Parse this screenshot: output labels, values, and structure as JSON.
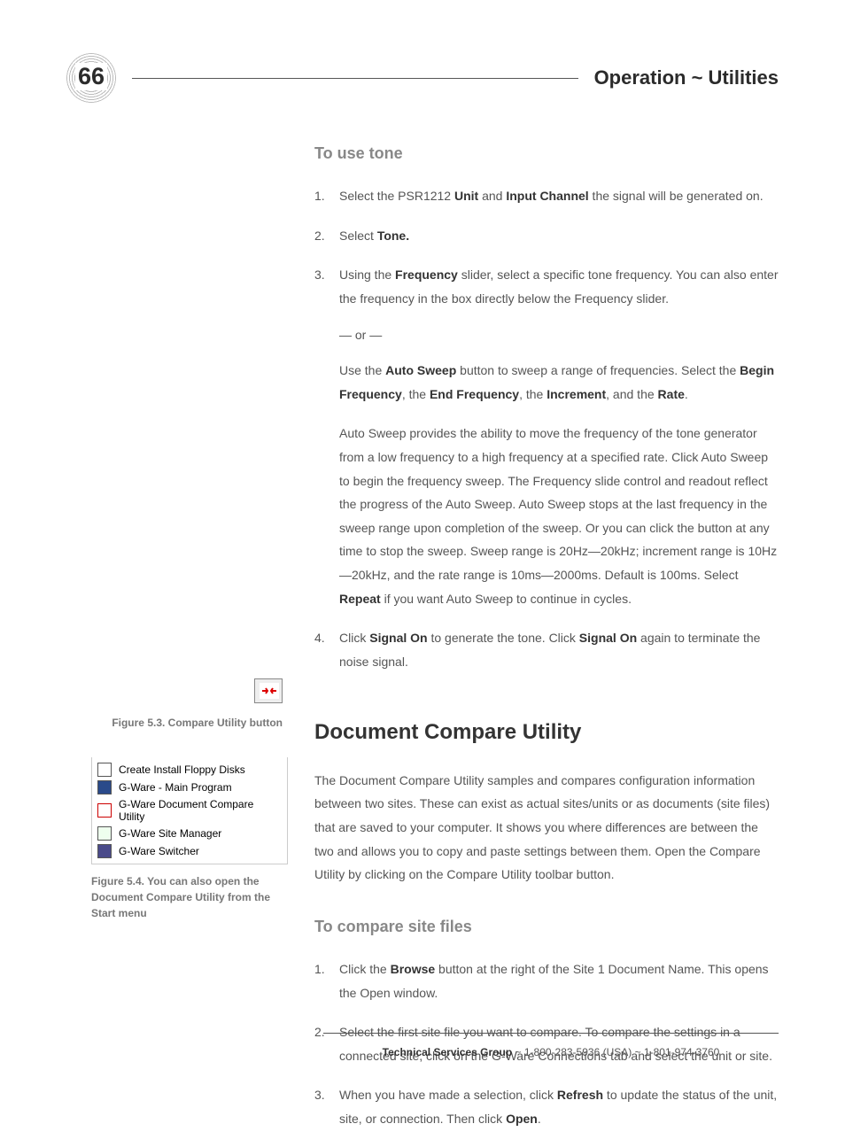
{
  "page_number": "66",
  "header_title": "Operation ~ Utilities",
  "section_tone": {
    "heading": "To use tone",
    "steps": {
      "s1_pre": "Select the PSR1212 ",
      "s1_b1": "Unit",
      "s1_mid": " and ",
      "s1_b2": "Input Channel",
      "s1_post": " the signal will be generated on.",
      "s2_pre": "Select ",
      "s2_b": "Tone.",
      "s3_pre": "Using the ",
      "s3_b": "Frequency",
      "s3_post": " slider, select a specific tone frequency. You can also enter the frequency in the box directly below the Frequency slider.",
      "or": "— or —",
      "s3b_pre": "Use the ",
      "s3b_b1": "Auto Sweep",
      "s3b_mid": " button to sweep a range of frequencies. Select the ",
      "s3b_b2": "Begin Frequency",
      "s3b_mid2": ", the ",
      "s3b_b3": "End Frequency",
      "s3b_mid3": ", the ",
      "s3b_b4": "Increment",
      "s3b_mid4": ", and the ",
      "s3b_b5": "Rate",
      "s3b_post": ".",
      "s3c_pre": "Auto Sweep provides the ability to move the frequency of the tone generator from a low frequency to a high frequency at a specified rate. Click Auto Sweep to begin the frequency sweep. The Frequency slide control and readout reflect the progress of the Auto Sweep. Auto Sweep stops at the last frequency in the sweep range upon completion of the sweep. Or you can click the button at any time to stop the sweep. Sweep range is 20Hz—20kHz; increment range is 10Hz—20kHz, and the rate range is 10ms—2000ms. Default is 100ms. Select ",
      "s3c_b": "Repeat",
      "s3c_post": " if you want Auto Sweep to continue in cycles.",
      "s4_pre": "Click ",
      "s4_b1": "Signal On",
      "s4_mid": " to generate the tone. Click ",
      "s4_b2": "Signal On",
      "s4_post": " again to terminate the noise signal."
    }
  },
  "section_compare": {
    "title": "Document Compare Utility",
    "intro": "The Document Compare Utility samples and compares configuration information between two sites. These can exist as actual sites/units or as documents (site files) that are saved to your computer. It shows you where differences are between the two and allows you to copy and paste settings between them. Open the Compare Utility by clicking on the Compare Utility toolbar button.",
    "heading2": "To compare site files",
    "steps": {
      "c1_pre": "Click the ",
      "c1_b": "Browse",
      "c1_post": " button at the right of the Site 1 Document Name. This opens the Open window.",
      "c2": "Select the first site file you want to compare. To compare the settings in a connected site, click on the G-Ware Connections tab and select the unit or site.",
      "c3_pre": "When you have made a selection, click ",
      "c3_b1": "Refresh",
      "c3_mid": " to update the status of the unit, site, or connection. Then click ",
      "c3_b2": "Open",
      "c3_post": "."
    }
  },
  "sidebar": {
    "caption1": "Figure 5.3. Compare Utility button",
    "menu_items": [
      "Create Install Floppy Disks",
      "G-Ware - Main Program",
      "G-Ware Document Compare Utility",
      "G-Ware Site Manager",
      "G-Ware Switcher"
    ],
    "caption2": "Figure 5.4. You can also open the Document Compare Utility from the Start menu"
  },
  "footer": {
    "b": "Technical Services Group",
    "rest": " ~ 1-800-283-5936 (USA) ~ 1-801-974-3760"
  }
}
